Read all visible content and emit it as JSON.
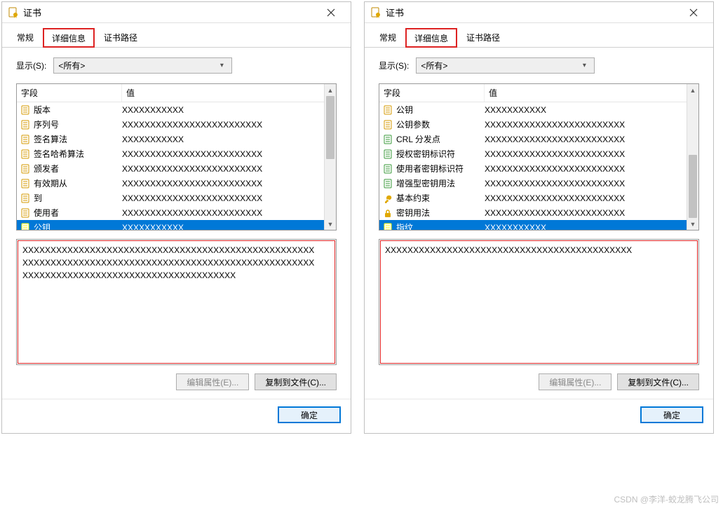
{
  "watermark": "CSDN @李洋-蛟龙腾飞公司",
  "window_left": {
    "title": "证书",
    "tabs": {
      "general": "常规",
      "details": "详细信息",
      "path": "证书路径",
      "active": "details"
    },
    "show": {
      "label": "显示(S):",
      "value": "<所有>"
    },
    "headers": {
      "field": "字段",
      "value": "值"
    },
    "rows": [
      {
        "icon": "doc",
        "field": "版本",
        "value": "XXXXXXXXXXX"
      },
      {
        "icon": "doc",
        "field": "序列号",
        "value": "XXXXXXXXXXXXXXXXXXXXXXXXX"
      },
      {
        "icon": "doc",
        "field": "签名算法",
        "value": "XXXXXXXXXXX"
      },
      {
        "icon": "doc",
        "field": "签名哈希算法",
        "value": "XXXXXXXXXXXXXXXXXXXXXXXXX"
      },
      {
        "icon": "doc",
        "field": "颁发者",
        "value": "XXXXXXXXXXXXXXXXXXXXXXXXX"
      },
      {
        "icon": "doc",
        "field": "有效期从",
        "value": "XXXXXXXXXXXXXXXXXXXXXXXXX"
      },
      {
        "icon": "doc",
        "field": "到",
        "value": "XXXXXXXXXXXXXXXXXXXXXXXXX"
      },
      {
        "icon": "doc",
        "field": "使用者",
        "value": "XXXXXXXXXXXXXXXXXXXXXXXXX"
      },
      {
        "icon": "doc",
        "field": "公钥",
        "value": "XXXXXXXXXXX",
        "selected": true
      }
    ],
    "detail": "XXXXXXXXXXXXXXXXXXXXXXXXXXXXXXXXXXXXXXXXXXXXXXXXXXXX\nXXXXXXXXXXXXXXXXXXXXXXXXXXXXXXXXXXXXXXXXXXXXXXXXXXXX\nXXXXXXXXXXXXXXXXXXXXXXXXXXXXXXXXXXXXXX",
    "buttons": {
      "edit": "编辑属性(E)...",
      "copy": "复制到文件(C)...",
      "ok": "确定"
    }
  },
  "window_right": {
    "title": "证书",
    "tabs": {
      "general": "常规",
      "details": "详细信息",
      "path": "证书路径",
      "active": "details"
    },
    "show": {
      "label": "显示(S):",
      "value": "<所有>"
    },
    "headers": {
      "field": "字段",
      "value": "值"
    },
    "rows": [
      {
        "icon": "doc",
        "field": "公钥",
        "value": "XXXXXXXXXXX"
      },
      {
        "icon": "doc",
        "field": "公钥参数",
        "value": "XXXXXXXXXXXXXXXXXXXXXXXXX"
      },
      {
        "icon": "ext",
        "field": "CRL 分发点",
        "value": "XXXXXXXXXXXXXXXXXXXXXXXXX"
      },
      {
        "icon": "ext",
        "field": "授权密钥标识符",
        "value": "XXXXXXXXXXXXXXXXXXXXXXXXX"
      },
      {
        "icon": "ext",
        "field": "使用者密钥标识符",
        "value": "XXXXXXXXXXXXXXXXXXXXXXXXX"
      },
      {
        "icon": "ext",
        "field": "增强型密钥用法",
        "value": "XXXXXXXXXXXXXXXXXXXXXXXXX"
      },
      {
        "icon": "key",
        "field": "基本约束",
        "value": "XXXXXXXXXXXXXXXXXXXXXXXXX"
      },
      {
        "icon": "lock",
        "field": "密钥用法",
        "value": "XXXXXXXXXXXXXXXXXXXXXXXXX"
      },
      {
        "icon": "doc",
        "field": "指纹",
        "value": "XXXXXXXXXXX",
        "selected": true
      }
    ],
    "detail": "XXXXXXXXXXXXXXXXXXXXXXXXXXXXXXXXXXXXXXXXXXXX",
    "buttons": {
      "edit": "编辑属性(E)...",
      "copy": "复制到文件(C)...",
      "ok": "确定"
    }
  }
}
